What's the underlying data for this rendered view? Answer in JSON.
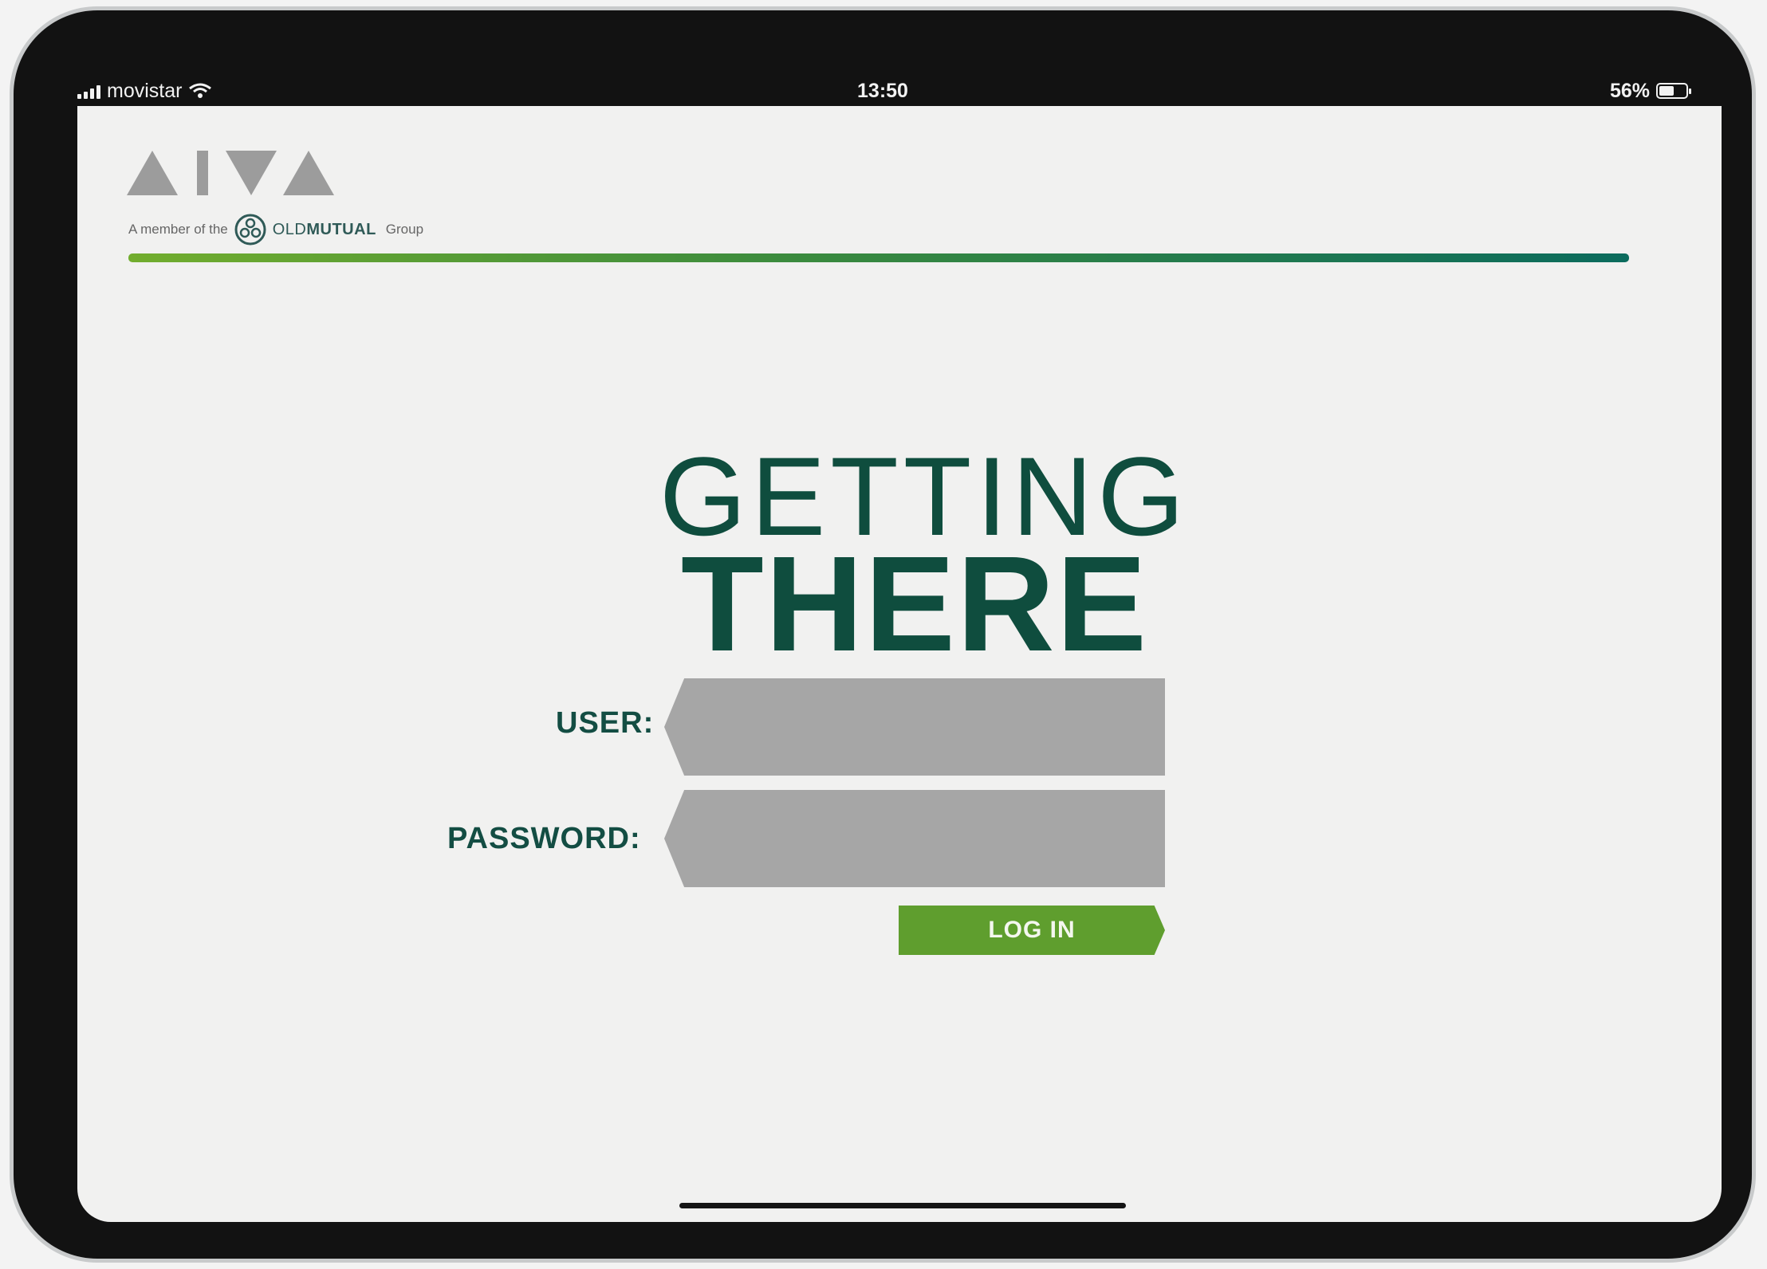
{
  "status_bar": {
    "carrier": "movistar",
    "time": "13:50",
    "battery_percent_text": "56%",
    "battery_level": 0.56,
    "signal_icon": "signal-bars-icon",
    "wifi_icon": "wifi-icon"
  },
  "brand": {
    "logo_text": "AIVA",
    "member_prefix": "A member of the",
    "partner_name_light": "OLD",
    "partner_name_bold": "MUTUAL",
    "partner_suffix": "Group",
    "colors": {
      "primary_green": "#0f4d3e",
      "button_green": "#5f9e2e",
      "rule_start": "#72ad2e",
      "rule_end": "#0b6b5d",
      "field_gray": "#a6a6a6"
    }
  },
  "hero": {
    "line1": "GETTING",
    "line2": "THERE"
  },
  "form": {
    "user_label": "USER:",
    "user_value": "",
    "password_label": "PASSWORD:",
    "password_value": "",
    "login_label": "LOG IN"
  }
}
